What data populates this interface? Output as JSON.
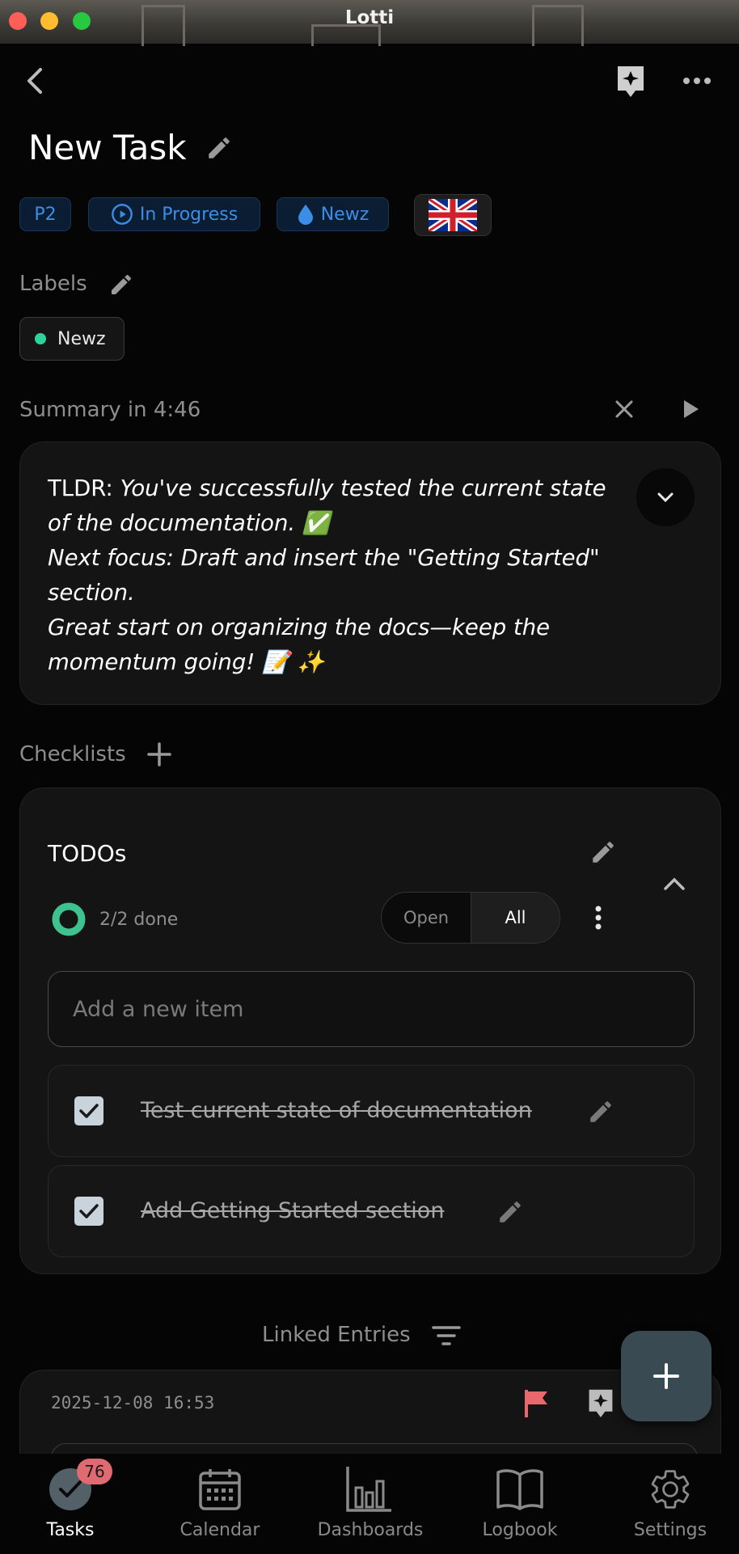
{
  "window": {
    "title": "Lotti"
  },
  "header": {
    "title": "New Task"
  },
  "chips": {
    "priority": "P2",
    "status": "In Progress",
    "category": "Newz"
  },
  "labels": {
    "heading": "Labels",
    "items": [
      "Newz"
    ]
  },
  "summary": {
    "heading": "Summary in 4:46",
    "tldr_prefix": "TLDR:",
    "tldr_text": "You've successfully tested the current state of the documentation. ✅",
    "next_focus": "Next focus: Draft and insert the \"Getting Started\" section.",
    "encouragement": "Great start on organizing the docs—keep the momentum going! 📝 ✨"
  },
  "checklists": {
    "heading": "Checklists",
    "list": {
      "title": "TODOs",
      "progress_text": "2/2 done",
      "filter_options": [
        "Open",
        "All"
      ],
      "selected_filter": "All",
      "add_placeholder": "Add a new item",
      "items": [
        {
          "label": "Test current state of documentation",
          "checked": true
        },
        {
          "label": "Add Getting Started section",
          "checked": true
        }
      ]
    }
  },
  "linked_entries": {
    "heading": "Linked Entries",
    "entry_timestamp": "2025-12-08 16:53"
  },
  "bottom_nav": {
    "items": [
      {
        "label": "Tasks",
        "badge": "76",
        "active": true
      },
      {
        "label": "Calendar"
      },
      {
        "label": "Dashboards"
      },
      {
        "label": "Logbook"
      },
      {
        "label": "Settings"
      }
    ]
  },
  "colors": {
    "accent_blue": "#3b8ee8",
    "progress_green": "#3ec28f",
    "flag_red": "#e8686b",
    "badge_red": "#e06a72",
    "label_dot": "#2fd39a"
  }
}
